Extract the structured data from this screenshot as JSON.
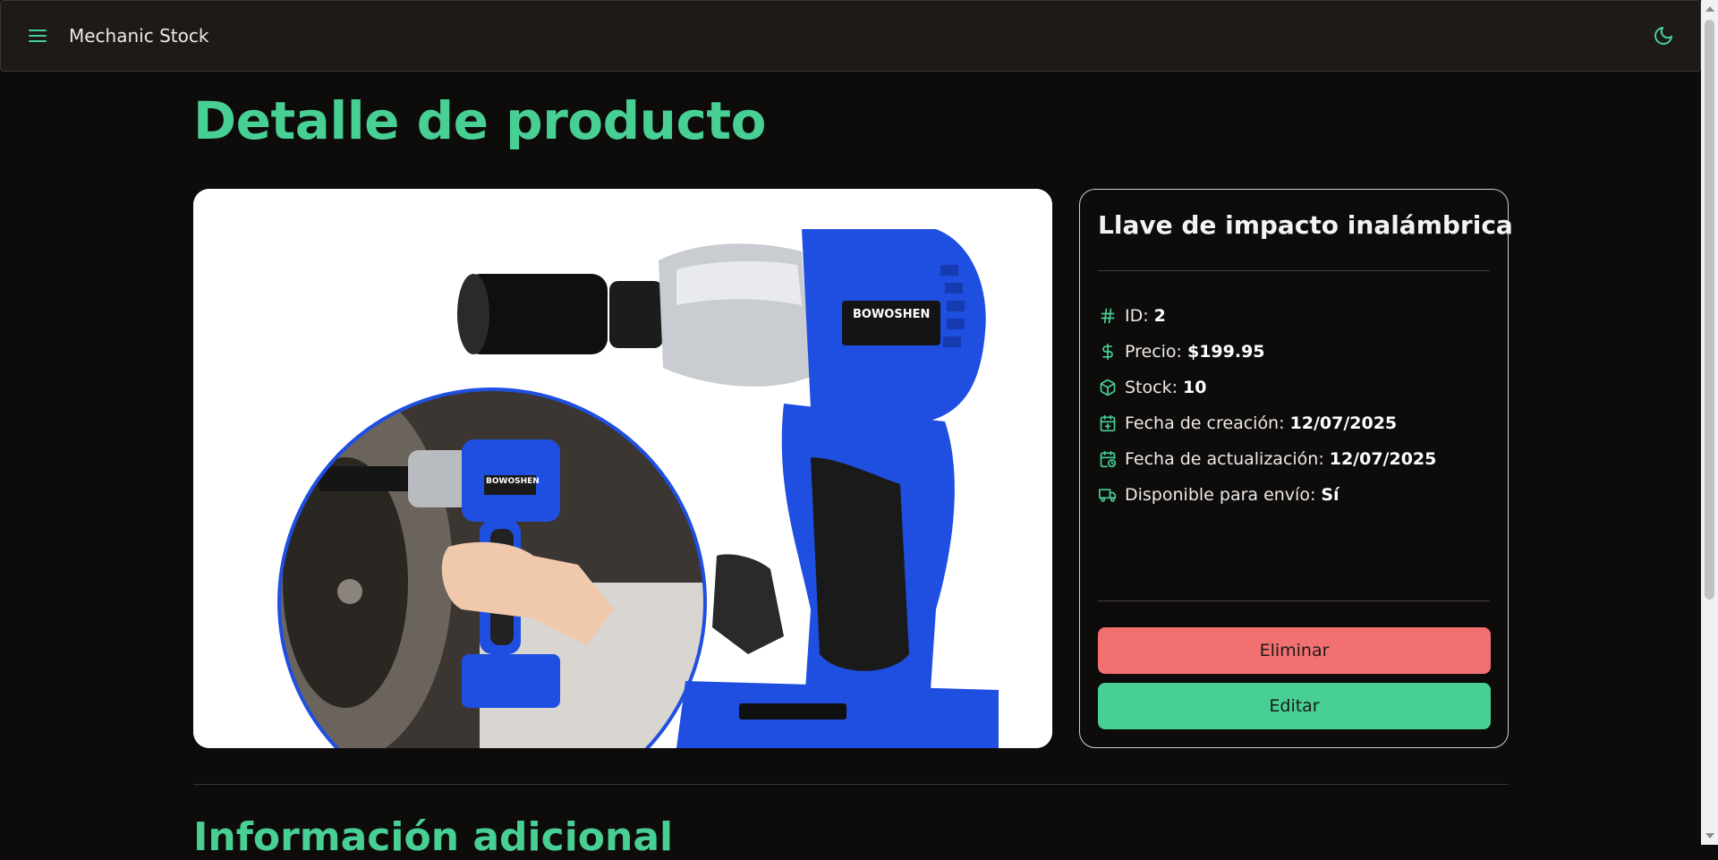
{
  "app": {
    "title": "Mechanic Stock"
  },
  "page": {
    "title": "Detalle de producto"
  },
  "product": {
    "name": "Llave de impacto inalámbrica",
    "image_brand_text": "BOWOSHEN",
    "image_brand_text_small": "BOWOSHEN",
    "specs": [
      {
        "icon": "hash-icon",
        "label": "ID:",
        "value": "2"
      },
      {
        "icon": "dollar-icon",
        "label": "Precio:",
        "value": "$199.95"
      },
      {
        "icon": "box-icon",
        "label": "Stock:",
        "value": "10"
      },
      {
        "icon": "calendar-plus-icon",
        "label": "Fecha de creación:",
        "value": "12/07/2025"
      },
      {
        "icon": "calendar-clock-icon",
        "label": "Fecha de actualización:",
        "value": "12/07/2025"
      },
      {
        "icon": "truck-icon",
        "label": "Disponible para envío:",
        "value": "Sí"
      }
    ]
  },
  "actions": {
    "delete_label": "Eliminar",
    "edit_label": "Editar"
  },
  "section": {
    "additional_info_title": "Información adicional"
  },
  "colors": {
    "accent": "#48cf93",
    "danger": "#f27170",
    "background": "#0e0c0b",
    "navbar": "#1d1a18"
  }
}
